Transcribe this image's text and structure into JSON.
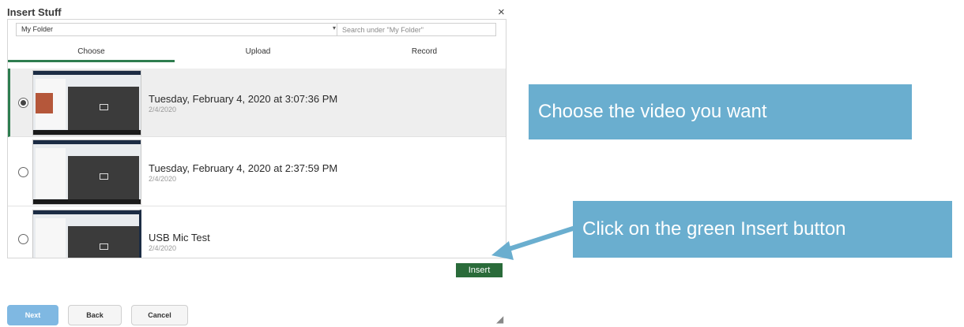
{
  "dialog": {
    "title": "Insert Stuff",
    "close_glyph": "×"
  },
  "folder": {
    "selected": "My Folder",
    "caret_glyph": "▾"
  },
  "search": {
    "placeholder": "Search under \"My Folder\""
  },
  "tabs": [
    {
      "label": "Choose",
      "active": true
    },
    {
      "label": "Upload",
      "active": false
    },
    {
      "label": "Record",
      "active": false
    }
  ],
  "recordings": [
    {
      "title": "Tuesday, February 4, 2020 at 3:07:36 PM",
      "date": "2/4/2020",
      "selected": true
    },
    {
      "title": "Tuesday, February 4, 2020 at 2:37:59 PM",
      "date": "2/4/2020",
      "selected": false
    },
    {
      "title": "USB Mic Test",
      "date": "2/4/2020",
      "selected": false
    }
  ],
  "actions": {
    "insert_label": "Insert",
    "next_label": "Next",
    "back_label": "Back",
    "cancel_label": "Cancel"
  },
  "callouts": {
    "choose_text": "Choose the video you want",
    "insert_text": "Click on the green Insert button"
  },
  "colors": {
    "accent_green": "#2e7d4f",
    "insert_green": "#2a6b3a",
    "callout_blue": "#6aaecf",
    "next_blue": "#7fb8e2"
  },
  "icons": {
    "close": "close-icon",
    "dropdown": "chevron-down-icon",
    "resize": "resize-grip-icon",
    "arrow": "arrow-icon"
  }
}
